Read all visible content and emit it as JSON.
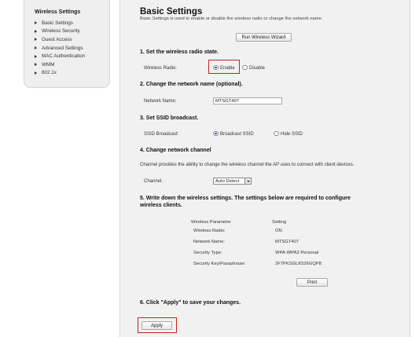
{
  "sidebar": {
    "title": "Wireless Settings",
    "items": [
      {
        "label": "Basic Settings"
      },
      {
        "label": "Wireless Security"
      },
      {
        "label": "Guest Access"
      },
      {
        "label": "Advanced Settings"
      },
      {
        "label": "MAC Authentication"
      },
      {
        "label": "WMM"
      },
      {
        "label": "802.1x"
      }
    ]
  },
  "main": {
    "title": "Basic Settings",
    "description": "Basic Settings is used to enable or disable the wireless radio or change the network name.",
    "wizard_button": "Run Wireless Wizard",
    "section1": {
      "title": "1. Set the wireless radio state.",
      "label": "Wireless Radio:",
      "option_enable": "Enable",
      "option_disable": "Disable",
      "selected": "Enable"
    },
    "section2": {
      "title": "2. Change the network name (optional).",
      "label": "Network Name:",
      "value": "MTSGT407"
    },
    "section3": {
      "title": "3. Set SSID broadcast.",
      "label": "SSID Broadcast:",
      "option_broadcast": "Broadcast SSID",
      "option_hide": "Hide SSID",
      "selected": "Broadcast SSID"
    },
    "section4": {
      "title": "4. Change network channel",
      "description": "Channel provides the ability to change the wireless channel the AP uses to connect with client devices.",
      "label": "Channel:",
      "value": "Auto Detect"
    },
    "section5": {
      "title_line1": "5. Write down the wireless settings. The settings below are required to configure",
      "title_line2": "wireless clients.",
      "col_param": "Wireless Parameter",
      "col_setting": "Setting",
      "rows": [
        {
          "param": "Wireless Radio:",
          "setting": "ON"
        },
        {
          "param": "Network Name:",
          "setting": "MTSGT407"
        },
        {
          "param": "Security Type:",
          "setting": "WPA-WPA2 Personal"
        },
        {
          "param": "Security Key/Passphrase:",
          "setting": "2F7PKSGLK526GQP8"
        }
      ],
      "print_button": "Print"
    },
    "section6": {
      "title": "6. Click \"Apply\" to save your changes.",
      "apply_button": "Apply"
    }
  },
  "colors": {
    "highlight": "#cc1f1f",
    "panel_bg": "#f1f1f1",
    "radio_dot": "#2a4f8a"
  }
}
